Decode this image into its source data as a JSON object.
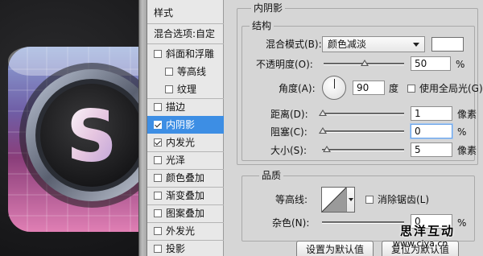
{
  "styles_panel": {
    "header": "样式",
    "blend_options": "混合选项:自定",
    "items": [
      {
        "label": "斜面和浮雕",
        "checked": false
      },
      {
        "label": "等高线",
        "checked": false
      },
      {
        "label": "纹理",
        "checked": false
      },
      {
        "label": "描边",
        "checked": false
      },
      {
        "label": "内阴影",
        "checked": true,
        "selected": true
      },
      {
        "label": "内发光",
        "checked": true
      },
      {
        "label": "光泽",
        "checked": false
      },
      {
        "label": "颜色叠加",
        "checked": false
      },
      {
        "label": "渐变叠加",
        "checked": false
      },
      {
        "label": "图案叠加",
        "checked": false
      },
      {
        "label": "外发光",
        "checked": false
      },
      {
        "label": "投影",
        "checked": false
      }
    ]
  },
  "inner_shadow": {
    "section_title": "内阴影",
    "structure_title": "结构",
    "blend_mode_label": "混合模式(B):",
    "blend_mode_value": "颜色减淡",
    "opacity_label": "不透明度(O):",
    "opacity_value": "50",
    "opacity_unit": "%",
    "angle_label": "角度(A):",
    "angle_value": "90",
    "angle_unit": "度",
    "global_light_label": "使用全局光(G)",
    "distance_label": "距离(D):",
    "distance_value": "1",
    "distance_unit": "像素",
    "choke_label": "阻塞(C):",
    "choke_value": "0",
    "choke_unit": "%",
    "size_label": "大小(S):",
    "size_value": "5",
    "size_unit": "像素",
    "quality_title": "品质",
    "contour_label": "等高线:",
    "antialias_label": "消除锯齿(L)",
    "noise_label": "杂色(N):",
    "noise_value": "0",
    "noise_unit": "%",
    "btn_make_default": "设置为默认值",
    "btn_reset_default": "复位为默认值"
  },
  "watermark": {
    "line1": "思洋互动",
    "line2": "www.ciya.cn"
  },
  "colors": {
    "selected": "#3d8ee4",
    "panel_bg": "#d6d6d6"
  }
}
